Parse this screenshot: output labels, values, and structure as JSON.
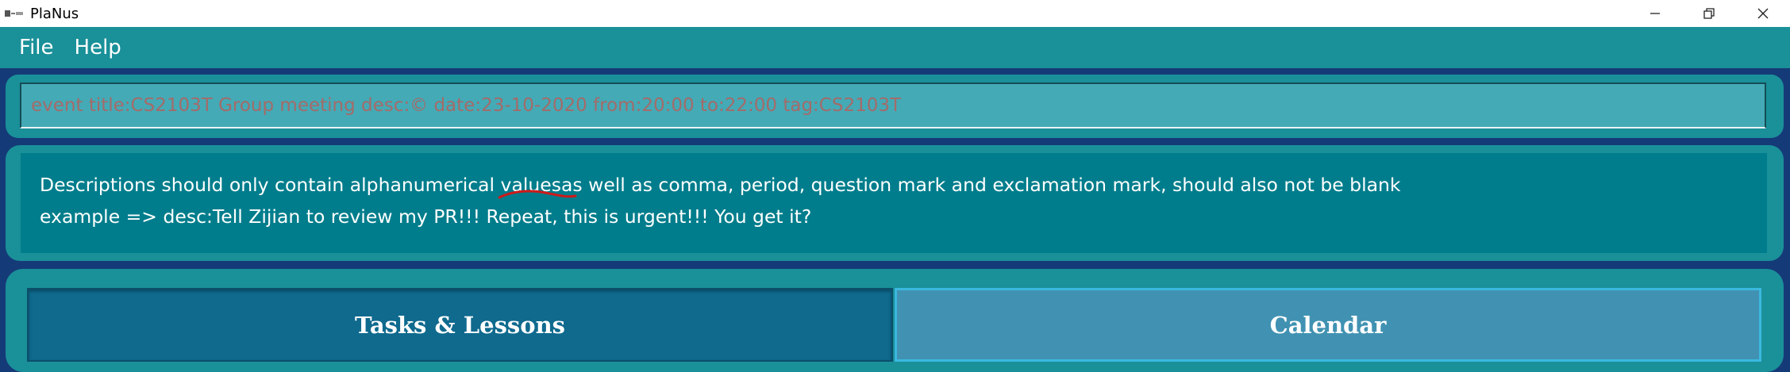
{
  "window": {
    "title": "PlaNus",
    "icon": "planus-app-icon",
    "controls": [
      "minimize-icon",
      "restore-icon",
      "close-icon"
    ]
  },
  "menu": {
    "file": "File",
    "help": "Help"
  },
  "command_box": {
    "value": "event title:CS2103T Group meeting desc:© date:23-10-2020 from:20:00 to:22:00 tag:CS2103T",
    "text_color": "#a46b69"
  },
  "result_display": {
    "line1_before": "Descriptions should only contain alphanumerical ",
    "line1_underlined": "valuesas",
    "line1_after": " well as comma, period, question mark and exclamation mark, should also not be blank",
    "line2": "example => desc:Tell Zijian to review my PR!!! Repeat, this is urgent!!! You get it?"
  },
  "tabs": {
    "tasks": "Tasks & Lessons",
    "calendar": "Calendar"
  },
  "colors": {
    "background": "#153a78",
    "panel": "#1a9099",
    "result_bg": "#007d8c",
    "tab_tasks": "#0f6a8e",
    "tab_calendar": "#4192b2",
    "annotation": "#cc1b1b"
  }
}
